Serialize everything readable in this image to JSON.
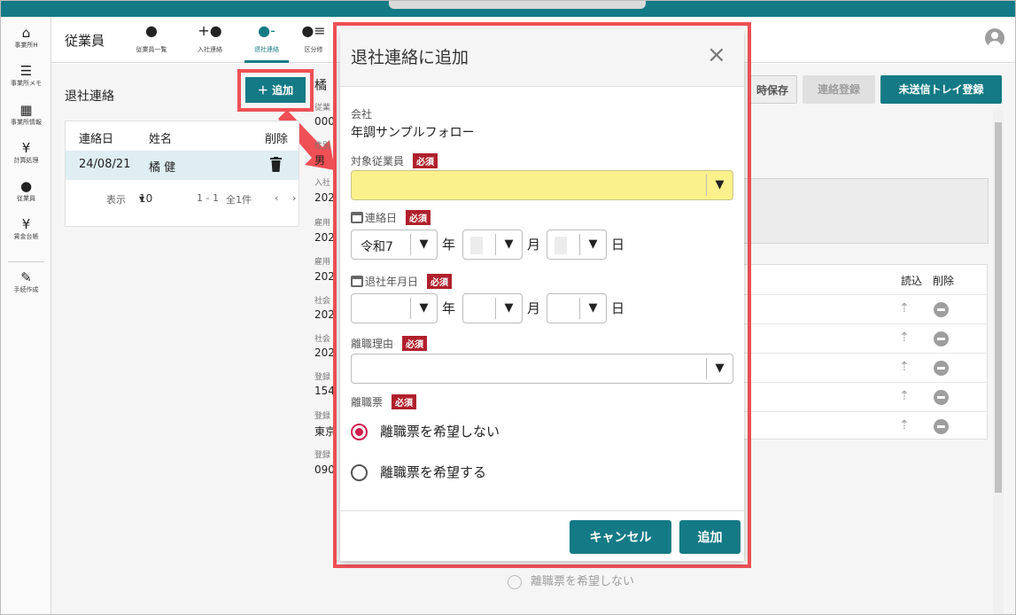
{
  "nav": {
    "items": [
      {
        "label": "事業所H",
        "icon": "office-home-icon"
      },
      {
        "label": "事業所メモ",
        "icon": "memo-icon"
      },
      {
        "label": "事業所情報",
        "icon": "building-icon"
      },
      {
        "label": "計算処理",
        "icon": "yen-calc-icon"
      },
      {
        "label": "従業員",
        "icon": "person-icon"
      },
      {
        "label": "賃金台帳",
        "icon": "ledger-icon"
      },
      {
        "label": "手続作成",
        "icon": "edit-doc-icon"
      }
    ]
  },
  "header": {
    "title": "従業員",
    "tabs": [
      {
        "label": "従業員一覧"
      },
      {
        "label": "入社連絡"
      },
      {
        "label": "退社連絡"
      },
      {
        "label": "区分修"
      }
    ]
  },
  "main": {
    "section_title": "退社連絡",
    "add_button": "＋ 追加",
    "detail_name_fragment": "橘",
    "detail_fields": [
      {
        "label": "従業",
        "value": "000"
      },
      {
        "label": "性別",
        "value": "男"
      },
      {
        "label": "入社",
        "value": "202"
      },
      {
        "label": "雇用",
        "value": "202"
      },
      {
        "label": "雇用",
        "value": "202"
      },
      {
        "label": "社会",
        "value": "202"
      },
      {
        "label": "社会",
        "value": "202"
      },
      {
        "label": "登録",
        "value": "154"
      },
      {
        "label": "登録",
        "value": "東京"
      },
      {
        "label": "登録",
        "value": "090"
      }
    ],
    "list": {
      "headers": [
        "連絡日",
        "姓名",
        "削除"
      ],
      "rows": [
        {
          "date": "24/08/21",
          "name": "橘 健"
        }
      ],
      "footer": {
        "display_label": "表示",
        "per_page": "10",
        "range": "1 - 1",
        "total": "全1件"
      }
    },
    "actions": {
      "temp_save": "時保存",
      "register": "連絡登録",
      "tray": "未送信トレイ登録"
    },
    "right_table": {
      "col_read": "読込",
      "col_delete": "削除"
    },
    "ghost_radio": "離職票を希望しない"
  },
  "modal": {
    "title": "退社連絡に追加",
    "close": "×",
    "required": "必須",
    "company_label": "会社",
    "company_value": "年調サンプルフォロー",
    "employee_label": "対象従業員",
    "contact_date_label": "連絡日",
    "era": "令和7",
    "year_unit": "年",
    "month_unit": "月",
    "day_unit": "日",
    "retire_date_label": "退社年月日",
    "reason_label": "離職理由",
    "slip_label": "離職票",
    "radio_no": "離職票を希望しない",
    "radio_yes": "離職票を希望する",
    "selected_radio": "no",
    "cancel": "キャンセル",
    "add": "追加"
  },
  "colors": {
    "brand": "#147a86",
    "highlight": "#ef5055",
    "required": "#b0202c",
    "field_focus": "#fbf18c",
    "radio_on": "#d21d4e"
  }
}
